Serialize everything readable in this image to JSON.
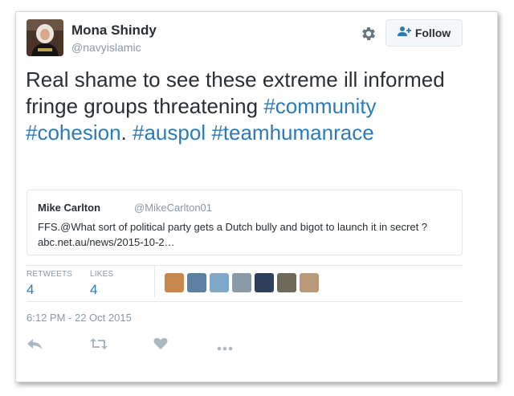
{
  "author": {
    "name": "Mona Shindy",
    "handle": "@navyislamic"
  },
  "follow": {
    "label": "Follow"
  },
  "tweet": {
    "text_plain": "Real shame to see these extreme ill informed fringe groups threatening",
    "hashtags": [
      "#community",
      "#cohesion",
      "#auspol",
      "#teamhumanrace"
    ],
    "separator": "."
  },
  "quoted": {
    "name": "Mike Carlton",
    "handle": "@MikeCarlton01",
    "text": "FFS.@What sort of political party gets a Dutch bully and bigot to launch it in secret ?",
    "link": "abc.net.au/news/2015-10-2…"
  },
  "stats": {
    "retweets_label": "RETWEETS",
    "retweets_value": "4",
    "likes_label": "LIKES",
    "likes_value": "4"
  },
  "liker_avatars": [
    {
      "color": "#c7874a"
    },
    {
      "color": "#5d7fa0"
    },
    {
      "color": "#7fa7c9"
    },
    {
      "color": "#8a9aa6"
    },
    {
      "color": "#2e3f5c"
    },
    {
      "color": "#6e6a5a"
    },
    {
      "color": "#b89a7a"
    }
  ],
  "timestamp": "6:12 PM - 22 Oct 2015",
  "icons": [
    "settings-gear-icon",
    "follow-person-plus-icon",
    "reply-icon",
    "retweet-icon",
    "like-heart-icon",
    "more-icon"
  ],
  "colors": {
    "accent": "#2b7bb9",
    "text": "#292f33",
    "muted": "#8899a6"
  }
}
